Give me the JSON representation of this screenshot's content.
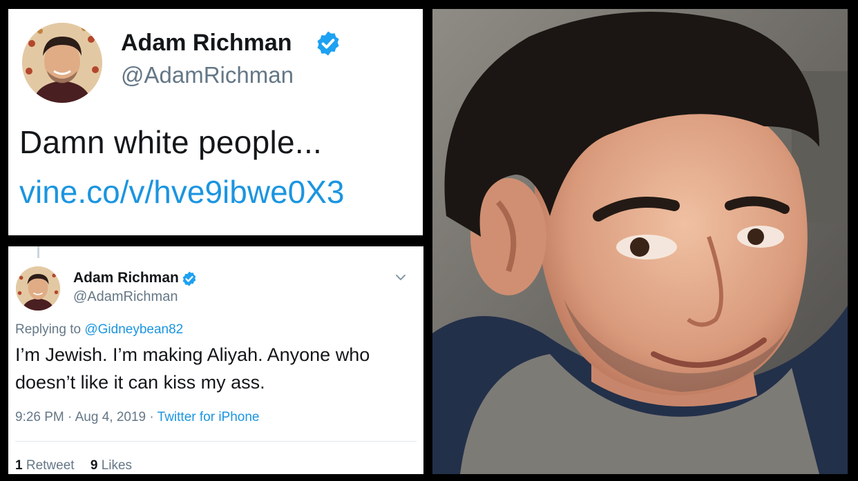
{
  "top_tweet": {
    "display_name": "Adam Richman",
    "handle": "@AdamRichman",
    "text": "Damn white people...",
    "link": "vine.co/v/hve9ibwe0X3"
  },
  "bottom_tweet": {
    "display_name": "Adam Richman",
    "handle": "@AdamRichman",
    "replying_prefix": "Replying to",
    "replying_to": "@Gidneybean82",
    "text": "I’m Jewish. I’m making Aliyah. Anyone who doesn’t like it can kiss my ass.",
    "time": "9:26 PM",
    "date": "Aug 4, 2019",
    "separator": "·",
    "source": "Twitter for iPhone",
    "retweets_count": "1",
    "retweets_label": "Retweet",
    "likes_count": "9",
    "likes_label": "Likes"
  },
  "colors": {
    "link_blue": "#1b95e0",
    "verified_blue": "#1da1f2",
    "secondary_text": "#657786",
    "primary_text": "#14171a"
  },
  "icons": {
    "verified": "verified-badge-icon",
    "caret": "chevron-down-icon"
  }
}
